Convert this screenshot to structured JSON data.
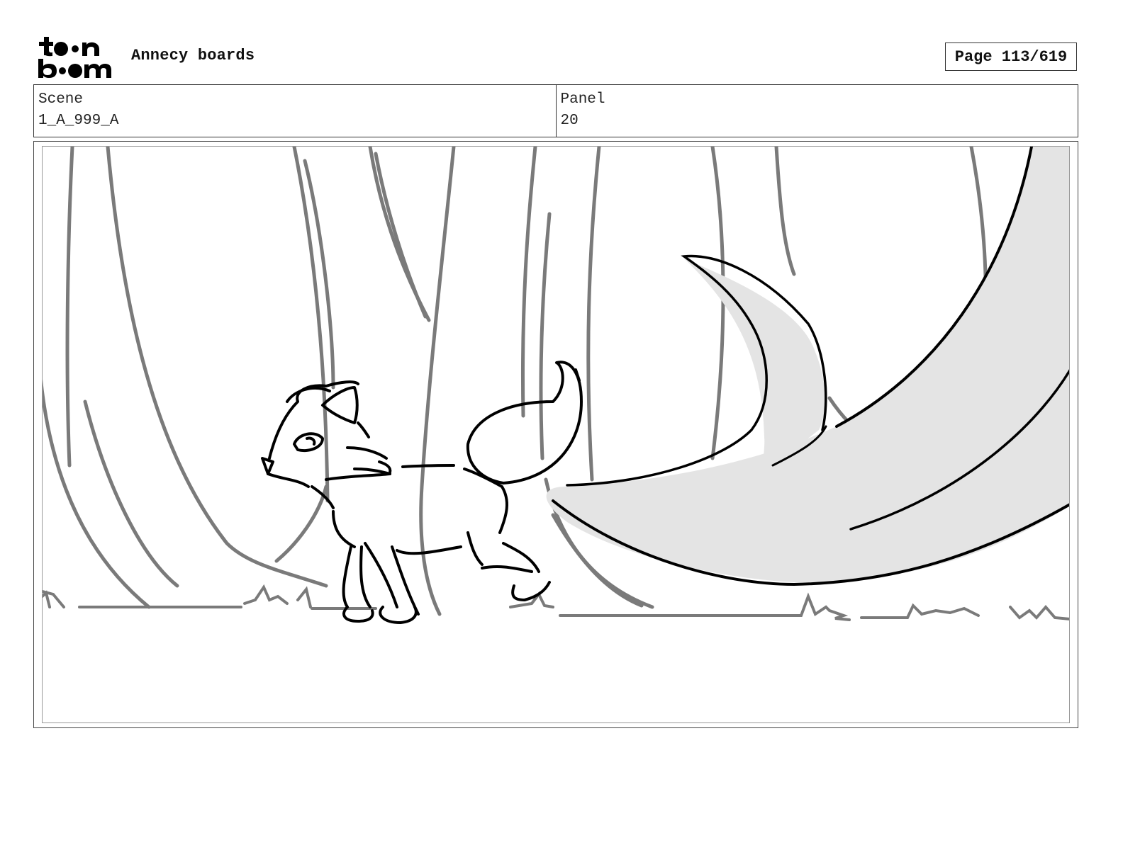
{
  "header": {
    "logo_text": "toon boom",
    "project_title": "Annecy boards",
    "page_indicator": "Page 113/619"
  },
  "info": {
    "scene_label": "Scene",
    "scene_value": "1_A_999_A",
    "panel_label": "Panel",
    "panel_value": "20"
  },
  "panel": {
    "subject": "fox-sketch",
    "colors": {
      "background_lines": "#7a7a7a",
      "foreground_lines": "#000000",
      "tail_fill": "#e4e4e4"
    }
  }
}
